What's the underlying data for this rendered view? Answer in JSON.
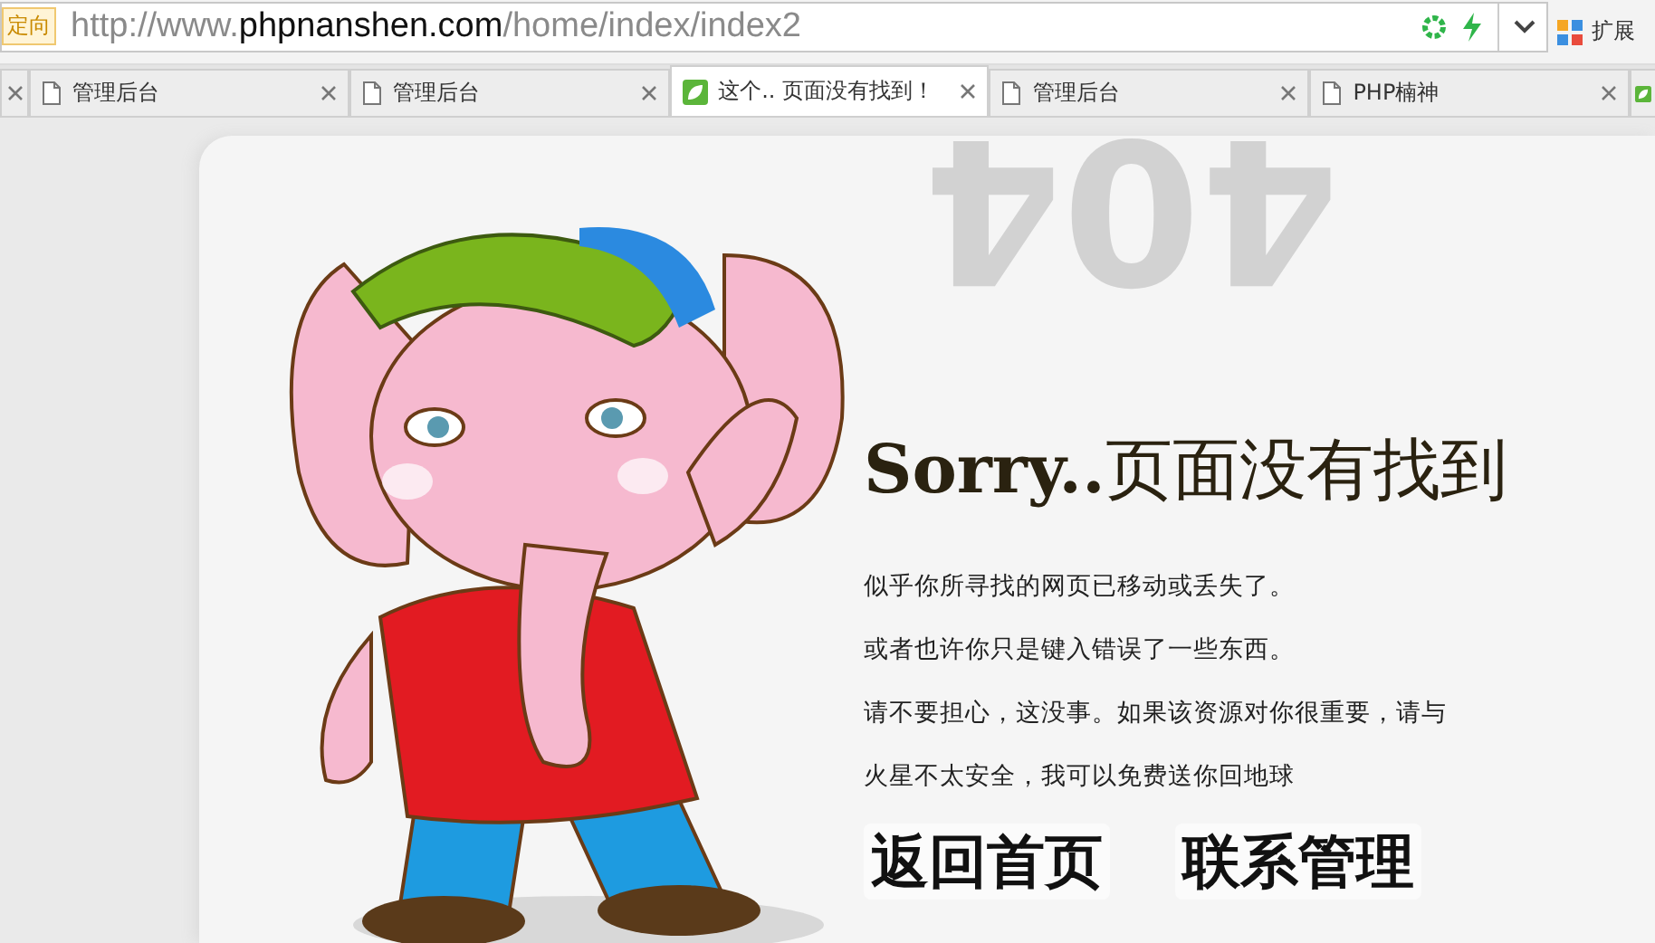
{
  "address_bar": {
    "badge": "定向",
    "url_parts": [
      {
        "text": "http://www.",
        "kind": "dim"
      },
      {
        "text": "phpnanshen.com",
        "kind": "main"
      },
      {
        "text": "/home/index/index2",
        "kind": "dim"
      }
    ],
    "extensions_label": "扩展"
  },
  "tabs": [
    {
      "kind": "stub",
      "selected": false
    },
    {
      "kind": "page",
      "label": "管理后台",
      "selected": false
    },
    {
      "kind": "page",
      "label": "管理后台",
      "selected": false
    },
    {
      "kind": "leaf",
      "label": "这个.. 页面没有找到！",
      "selected": true
    },
    {
      "kind": "page",
      "label": "管理后台",
      "selected": false
    },
    {
      "kind": "page",
      "label": "PHP楠神",
      "selected": false
    },
    {
      "kind": "edge",
      "selected": false
    }
  ],
  "page": {
    "background_text": "404",
    "heading": "**Sorry..**页面没有找到",
    "paragraphs": [
      "似乎你所寻找的网页已移动或丢失了。",
      "或者也许你只是键入错误了一些东西。",
      "请不要担心，这没事。如果该资源对你很重要，请与",
      "火星不太安全，我可以免费送你回地球"
    ],
    "buttons": [
      "返回首页",
      "联系管理"
    ]
  }
}
